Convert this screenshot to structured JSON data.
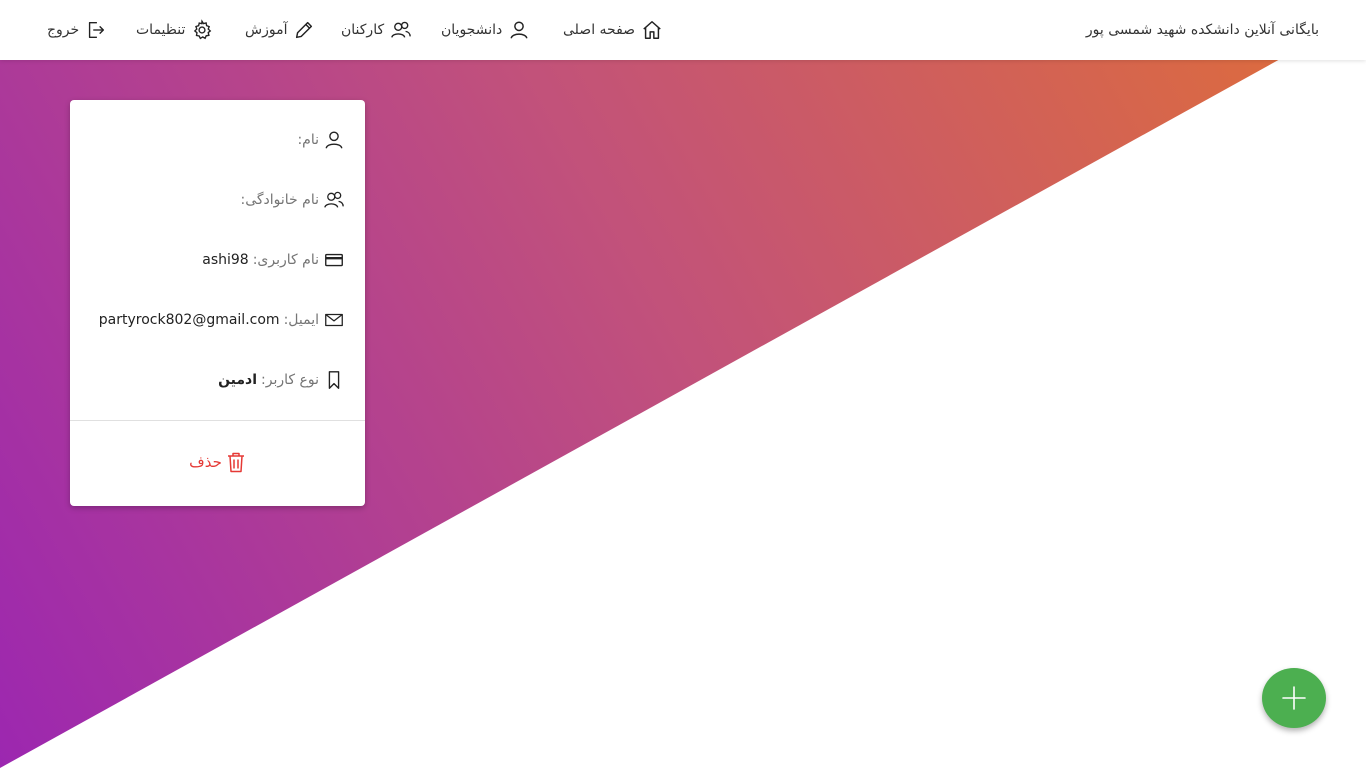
{
  "header": {
    "brand": "بایگانی آنلاین دانشکده شهید شمسی پور",
    "nav": [
      {
        "label": "صفحه اصلی",
        "icon": "home-icon"
      },
      {
        "label": "دانشجویان",
        "icon": "user-icon"
      },
      {
        "label": "کارکنان",
        "icon": "users-icon"
      },
      {
        "label": "آموزش",
        "icon": "pencil-icon"
      },
      {
        "label": "تنظیمات",
        "icon": "gear-icon"
      },
      {
        "label": "خروج",
        "icon": "logout-icon"
      }
    ]
  },
  "card": {
    "first_name": {
      "label": "نام:",
      "value": "",
      "icon": "user-icon"
    },
    "last_name": {
      "label": "نام خانوادگی:",
      "value": "",
      "icon": "users-icon"
    },
    "username": {
      "label": "نام کاربری:",
      "value": "ashi98",
      "icon": "card-icon"
    },
    "email": {
      "label": "ایمیل:",
      "value": "partyrock802@gmail.com",
      "icon": "mail-icon"
    },
    "user_type": {
      "label": "نوع کاربر:",
      "value": "ادمین",
      "icon": "bookmark-icon"
    },
    "delete_label": "حذف"
  },
  "fab": {
    "icon": "plus-icon"
  },
  "colors": {
    "gradient_start": "#9c27b0",
    "gradient_mid": "#c2566e",
    "gradient_end": "#d96a44",
    "delete": "#e53935",
    "fab": "#4caf50"
  }
}
